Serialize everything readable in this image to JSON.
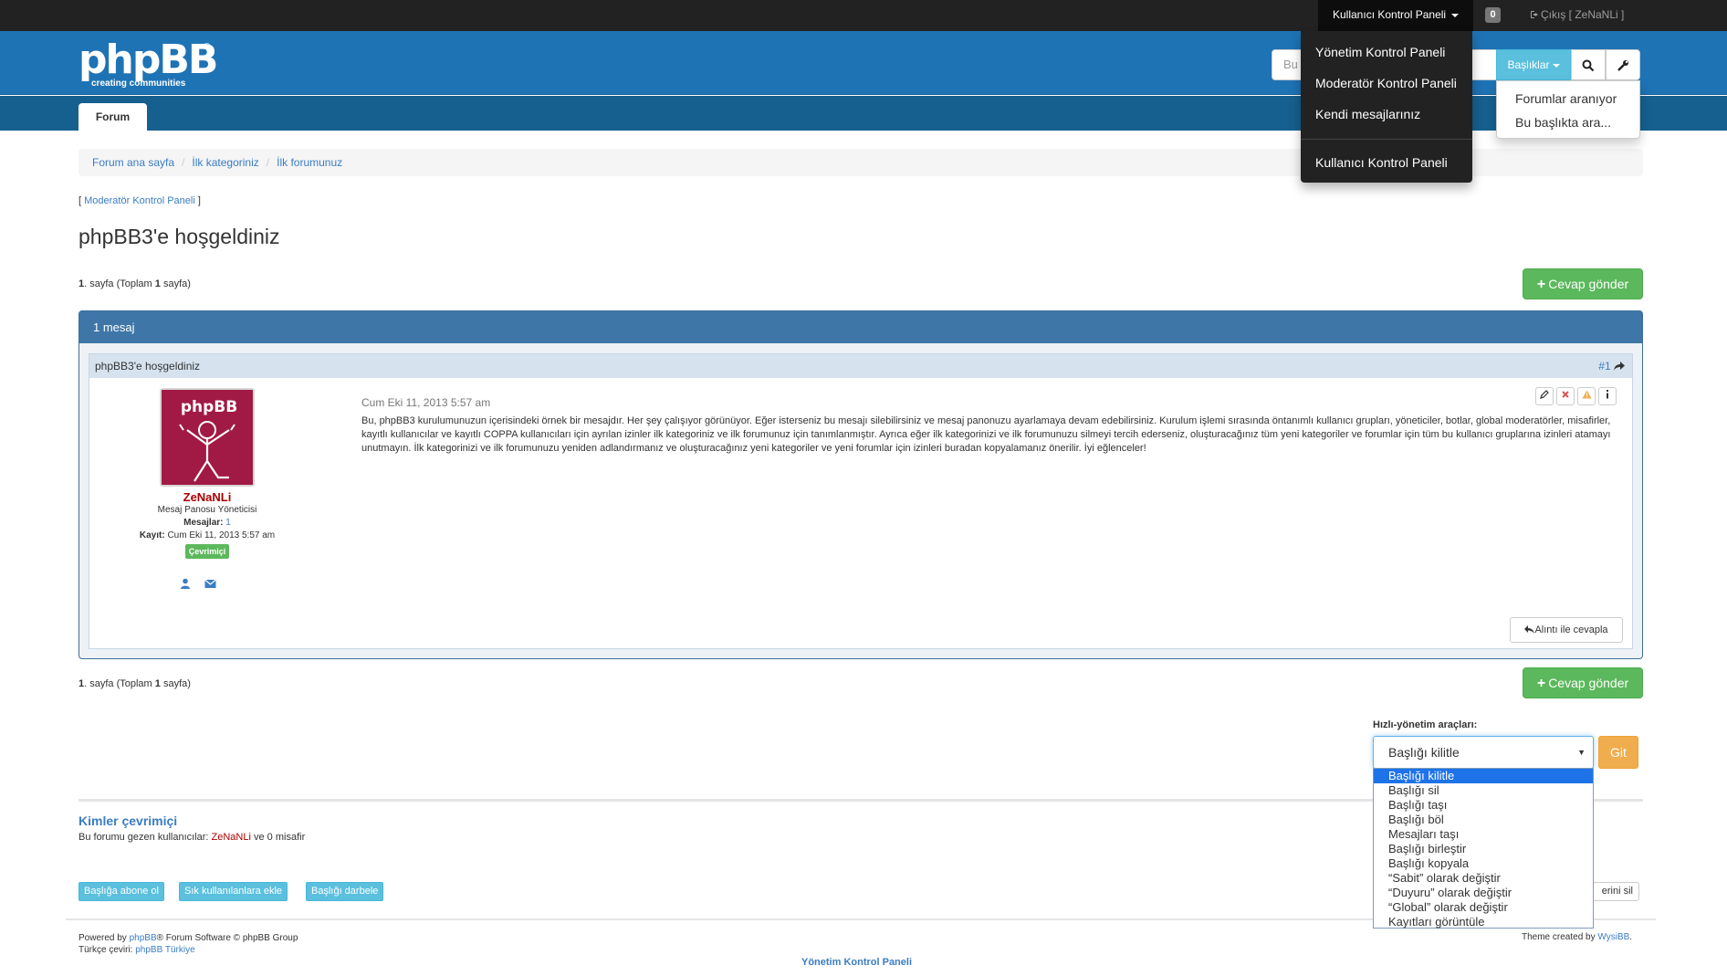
{
  "topbar": {
    "ucp_label": "Kullanıcı Kontrol Paneli",
    "notifications_count": "0",
    "logout_label": "Çıkış [ ZeNaNLi ]"
  },
  "logo": {
    "text": "phpBB",
    "registered": "®",
    "slogan": "creating   communities"
  },
  "search": {
    "placeholder": "Bu",
    "topics_button": "Başlıklar",
    "topics_menu": [
      "Forumlar aranıyor",
      "Bu başlıkta ara..."
    ]
  },
  "ucp_menu": {
    "items": [
      "Yönetim Kontrol Paneli",
      "Moderatör Kontrol Paneli",
      "Kendi mesajlarınız"
    ],
    "bottom_item": "Kullanıcı Kontrol Paneli"
  },
  "nav": {
    "tab_forum": "Forum"
  },
  "breadcrumb": [
    "Forum ana sayfa",
    "İlk kategoriniz",
    "İlk forumunuz"
  ],
  "mcp_link": {
    "open": "[ ",
    "label": "Moderatör Kontrol Paneli",
    "close": " ]"
  },
  "page_title": "phpBB3'e hoşgeldiniz",
  "pagination": {
    "page": "1",
    "text1": ". sayfa (Toplam ",
    "total": "1",
    "text2": " sayfa)"
  },
  "reply_button": "Cevap gönder",
  "panel": {
    "heading": "1 mesaj"
  },
  "post": {
    "subject": "phpBB3'e hoşgeldiniz",
    "number": "#1",
    "date": "Cum Eki 11, 2013 5:57 am",
    "body": "Bu, phpBB3 kurulumunuzun içerisindeki örnek bir mesajdır. Her şey çalışıyor görünüyor. Eğer isterseniz bu mesajı silebilirsiniz ve mesaj panonuzu ayarlamaya devam edebilirsiniz. Kurulum işlemi sırasında öntanımlı kullanıcı grupları, yöneticiler, botlar, global moderatörler, misafirler, kayıtlı kullanıcılar ve kayıtlı COPPA kullanıcıları için ayrılan izinler ilk kategoriniz ve ilk forumunuz için tanımlanmıştır. Ayrıca eğer ilk kategorinizi ve ilk forumunuzu silmeyi tercih ederseniz, oluşturacağınız tüm yeni kategoriler ve forumlar için tüm bu kullanıcı gruplarına izinleri atamayı unutmayın. İlk kategorinizi ve ilk forumunuzu yeniden adlandırmanız ve oluşturacağınız yeni kategoriler ve yeni forumlar için izinleri buradan kopyalamanız önerilir. İyi eğlenceler!",
    "quote_button": "Alıntı ile cevapla",
    "author": {
      "username": "ZeNaNLi",
      "rank": "Mesaj Panosu Yöneticisi",
      "posts_label": "Mesajlar:",
      "posts_value": "1",
      "joined_label": "Kayıt:",
      "joined_value": "Cum Eki 11, 2013 5:57 am",
      "status": "Çevrimiçi",
      "avatar_text": "phpBB"
    }
  },
  "quick_mod": {
    "label": "Hızlı-yönetim araçları:",
    "selected": "Başlığı kilitle",
    "go_button": "Git",
    "options": [
      "Başlığı kilitle",
      "Başlığı sil",
      "Başlığı taşı",
      "Başlığı böl",
      "Mesajları taşı",
      "Başlığı birleştir",
      "Başlığı kopyala",
      "“Sabit” olarak değiştir",
      "“Duyuru” olarak değiştir",
      "“Global” olarak değiştir",
      "Kayıtları görüntüle"
    ]
  },
  "who_online": {
    "title": "Kimler çevrimiçi",
    "prefix": "Bu forumu gezen kullanıcılar: ",
    "user": "ZeNaNLi",
    "suffix": " ve 0 misafir"
  },
  "bottom_buttons": [
    "Başlığa abone ol",
    "Sık kullanılanlara ekle",
    "Başlığı darbele"
  ],
  "delete_button_partial": "erini sil",
  "footer": {
    "powered_prefix": "Powered by ",
    "powered_link": "phpBB",
    "powered_suffix": "® Forum Software © phpBB Group",
    "translation_prefix": "Türkçe çeviri: ",
    "translation_link": "phpBB Türkiye",
    "theme_prefix": "Theme created by ",
    "theme_link": "WysiBB",
    "theme_suffix": ".",
    "acp_link": "Yönetim Kontrol Paneli"
  }
}
